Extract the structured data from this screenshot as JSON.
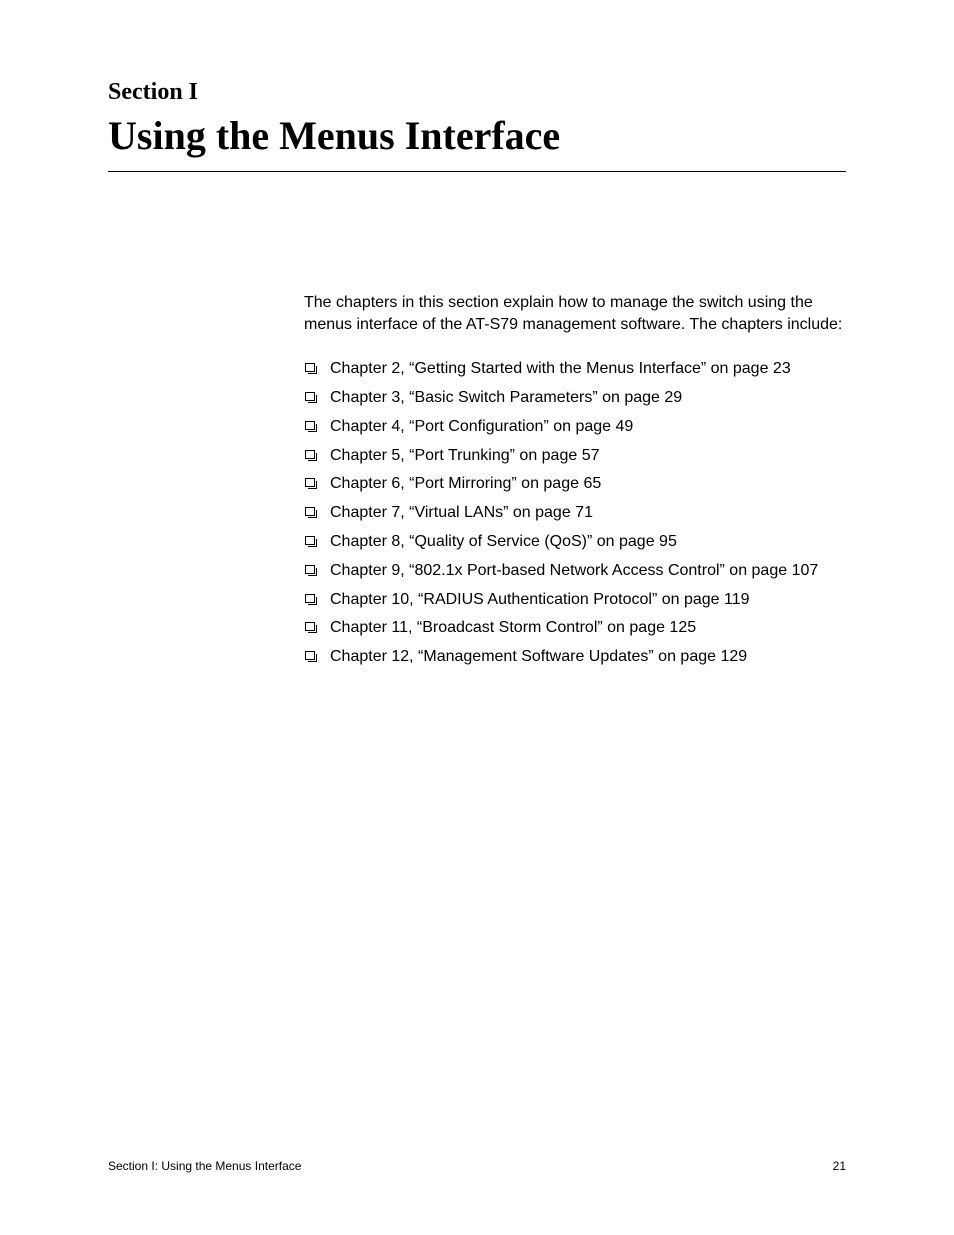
{
  "section_label": "Section I",
  "section_title": "Using the Menus Interface",
  "intro": "The chapters in this section explain how to manage the switch using the menus interface of the AT-S79 management software. The chapters include:",
  "chapters": [
    "Chapter 2, “Getting Started with the Menus Interface” on page 23",
    "Chapter 3, “Basic Switch Parameters” on page 29",
    "Chapter 4, “Port Configuration” on page 49",
    "Chapter 5, “Port Trunking” on page 57",
    "Chapter 6, “Port Mirroring” on page 65",
    "Chapter 7, “Virtual LANs” on page 71",
    "Chapter 8, “Quality of Service (QoS)” on page 95",
    "Chapter 9, “802.1x Port-based Network Access Control” on page 107",
    "Chapter 10, “RADIUS Authentication Protocol” on page 119",
    "Chapter 11, “Broadcast Storm Control” on page 125",
    "Chapter 12, “Management Software Updates” on page 129"
  ],
  "footer_left": "Section I: Using the Menus Interface",
  "footer_right": "21"
}
